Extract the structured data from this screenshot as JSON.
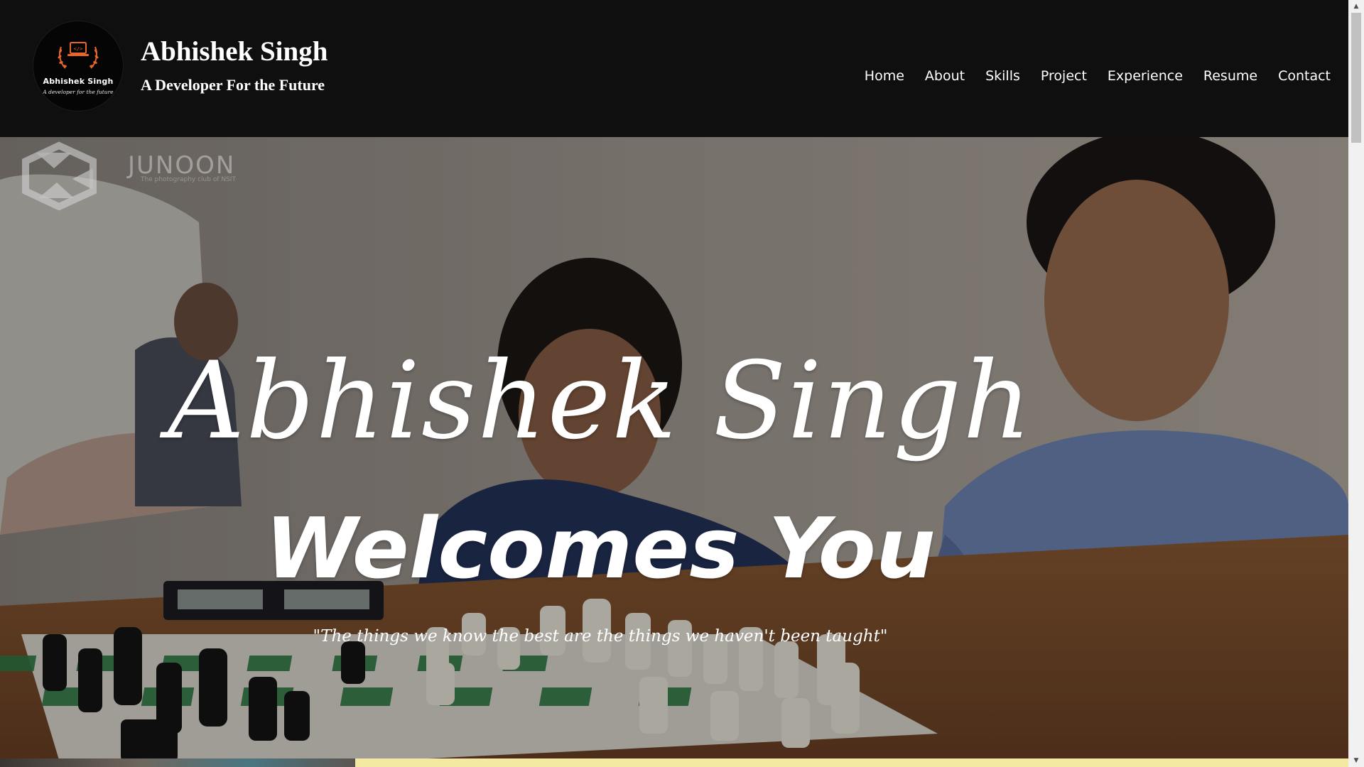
{
  "header": {
    "logo": {
      "name": "Abhishek Singh",
      "tagline": "A developer for the future"
    },
    "title": "Abhishek Singh",
    "tagline": "A Developer For the Future"
  },
  "nav": {
    "items": [
      {
        "label": "Home"
      },
      {
        "label": "About"
      },
      {
        "label": "Skills"
      },
      {
        "label": "Project"
      },
      {
        "label": "Experience"
      },
      {
        "label": "Resume"
      },
      {
        "label": "Contact"
      }
    ]
  },
  "hero": {
    "name": "Abhishek Singh",
    "welcome": "Welcomes You",
    "quote": "\"The things we know the best are the things we haven't been taught\"",
    "watermark": {
      "title": "JUNOON",
      "subtitle": "The photography club of NSIT",
      "badge": "JUNOON"
    }
  },
  "colors": {
    "header_bg": "#0f0f0f",
    "logo_accent": "#e8662a",
    "text": "#ffffff",
    "bottom_accent": "#f3e9a3"
  }
}
